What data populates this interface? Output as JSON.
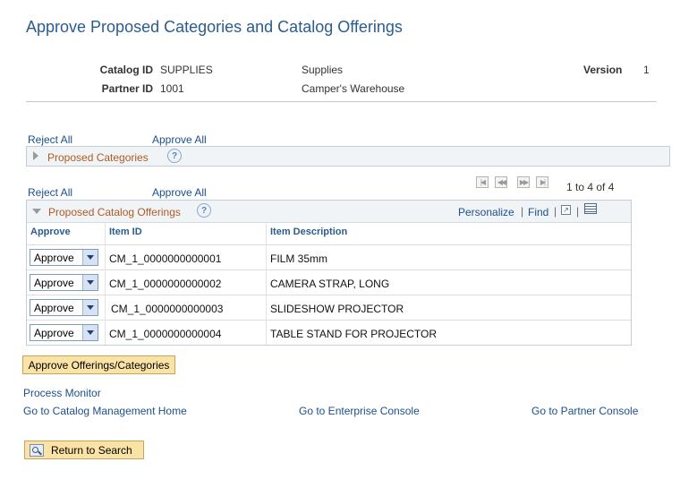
{
  "page": {
    "title": "Approve Proposed Categories and Catalog Offerings"
  },
  "header": {
    "catalog_id_label": "Catalog ID",
    "catalog_id_value": "SUPPLIES",
    "catalog_desc": "Supplies",
    "version_label": "Version",
    "version_value": "1",
    "partner_id_label": "Partner ID",
    "partner_id_value": "1001",
    "partner_desc": "Camper's Warehouse"
  },
  "categories": {
    "reject_all": "Reject All",
    "approve_all": "Approve All",
    "title": "Proposed Categories",
    "help_icon": "help-icon"
  },
  "offerings": {
    "reject_all": "Reject All",
    "approve_all": "Approve All",
    "title": "Proposed Catalog Offerings",
    "count": "1 to 4 of 4",
    "personalize": "Personalize",
    "find": "Find",
    "columns": {
      "approve": "Approve",
      "item_id": "Item ID",
      "item_desc": "Item Description"
    },
    "rows": [
      {
        "approve": "Approve",
        "item_id": "CM_1_0000000000001",
        "desc": "FILM 35mm"
      },
      {
        "approve": "Approve",
        "item_id": "CM_1_0000000000002",
        "desc": "CAMERA STRAP, LONG"
      },
      {
        "approve": "Approve",
        "item_id": "CM_1_0000000000003",
        "desc": "SLIDESHOW PROJECTOR"
      },
      {
        "approve": "Approve",
        "item_id": "CM_1_0000000000004",
        "desc": "TABLE STAND FOR PROJECTOR"
      }
    ]
  },
  "actions": {
    "approve_button": "Approve Offerings/Categories",
    "process_monitor": "Process Monitor",
    "catalog_home": "Go to Catalog Management Home",
    "enterprise_console": "Go to Enterprise Console",
    "partner_console": "Go to Partner Console",
    "return_to_search": "Return to Search"
  },
  "colors": {
    "link": "#1c4f8c",
    "section_title": "#b05a23",
    "button_bg": "#fbe3a6"
  }
}
